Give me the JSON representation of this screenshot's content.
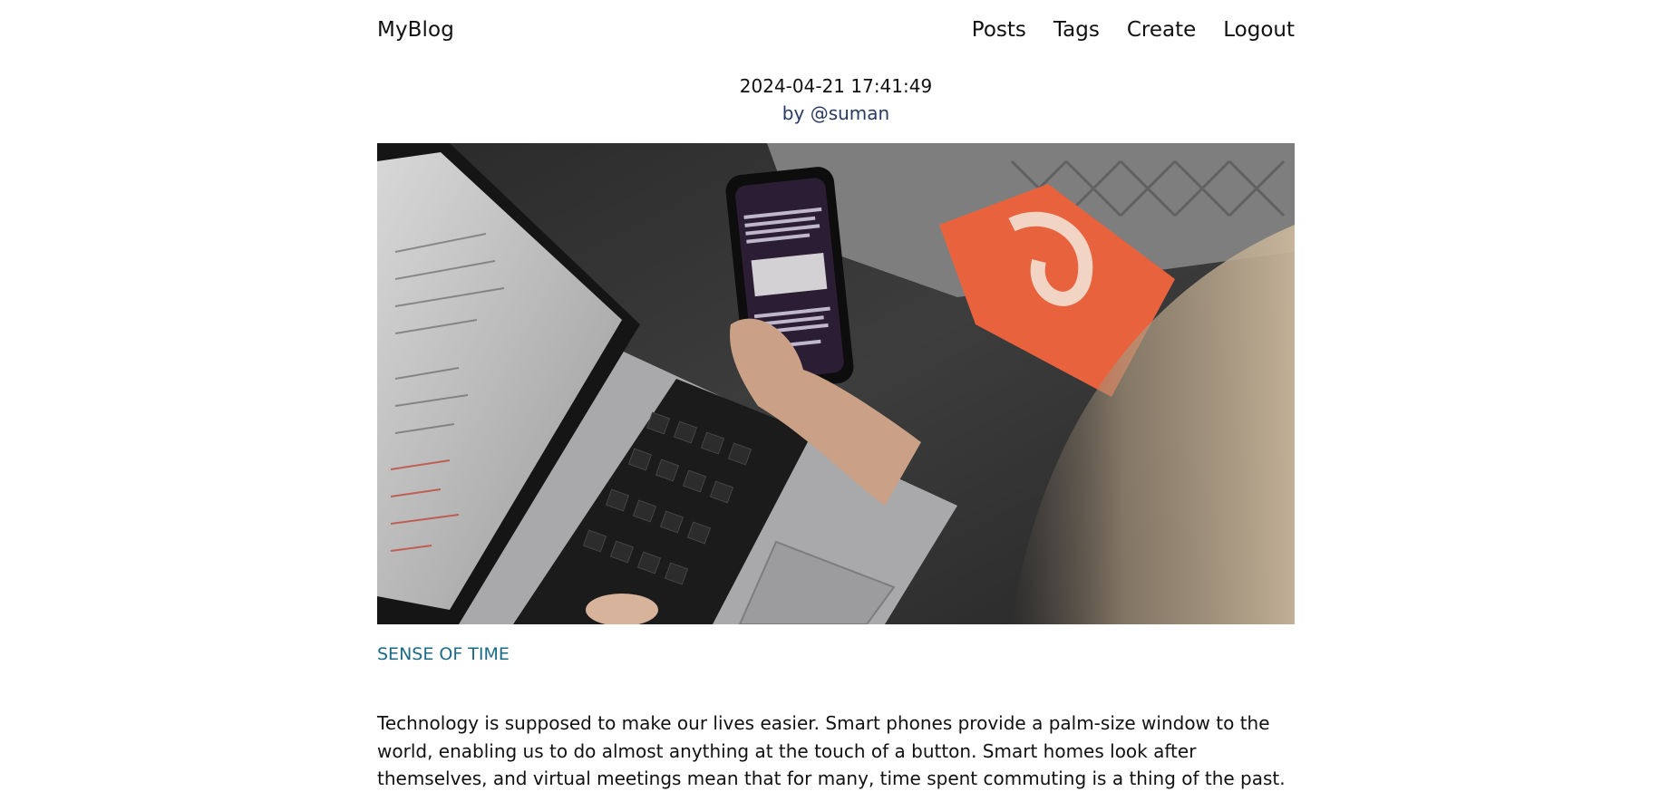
{
  "navbar": {
    "brand": "MyBlog",
    "links": [
      "Posts",
      "Tags",
      "Create",
      "Logout"
    ]
  },
  "post": {
    "timestamp": "2024-04-21 17:41:49",
    "author_prefix": "by",
    "author_handle": "@suman",
    "tag": "SENSE OF TIME",
    "body": "Technology is supposed to make our lives easier. Smart phones provide a palm-size window to the world, enabling us to do almost anything at the touch of a button. Smart homes look after themselves, and virtual meetings mean that for many, time spent commuting is a thing of the past."
  },
  "colors": {
    "author": "#283a63",
    "tag": "#1b6a86",
    "text": "#111111"
  },
  "image": {
    "icon": "photo-laptop-phone"
  }
}
